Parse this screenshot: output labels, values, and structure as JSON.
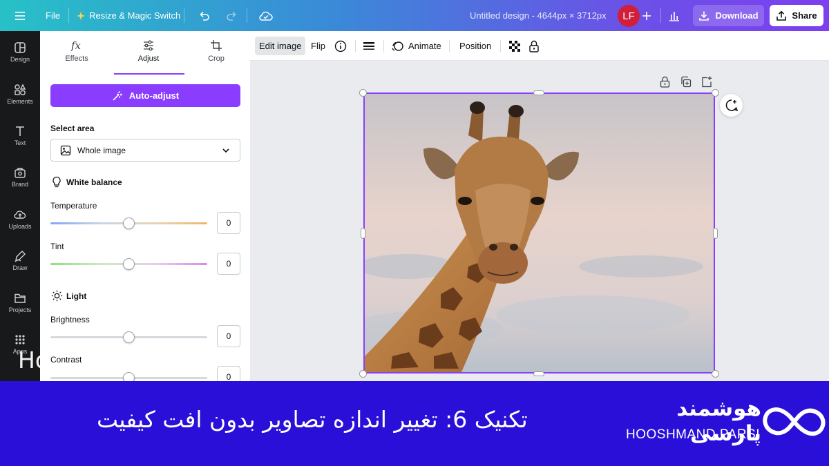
{
  "topbar": {
    "file_label": "File",
    "resize_label": "Resize & Magic Switch",
    "doc_title": "Untitled design - 4644px × 3712px",
    "avatar_initials": "LF",
    "download_label": "Download",
    "share_label": "Share"
  },
  "rail": {
    "items": [
      {
        "label": "Design",
        "icon": "design-icon"
      },
      {
        "label": "Elements",
        "icon": "elements-icon"
      },
      {
        "label": "Text",
        "icon": "text-icon"
      },
      {
        "label": "Brand",
        "icon": "brand-icon"
      },
      {
        "label": "Uploads",
        "icon": "uploads-icon"
      },
      {
        "label": "Draw",
        "icon": "draw-icon"
      },
      {
        "label": "Projects",
        "icon": "projects-icon"
      },
      {
        "label": "Apps",
        "icon": "apps-icon"
      }
    ]
  },
  "panel": {
    "tabs": [
      {
        "label": "Effects",
        "icon": "fx-icon"
      },
      {
        "label": "Adjust",
        "icon": "sliders-icon"
      },
      {
        "label": "Crop",
        "icon": "crop-icon"
      }
    ],
    "active_tab": "Adjust",
    "auto_adjust_label": "Auto-adjust",
    "select_area_label": "Select area",
    "select_area_value": "Whole image",
    "white_balance_heading": "White balance",
    "temperature_label": "Temperature",
    "temperature_value": "0",
    "tint_label": "Tint",
    "tint_value": "0",
    "light_heading": "Light",
    "brightness_label": "Brightness",
    "brightness_value": "0",
    "contrast_label": "Contrast",
    "contrast_value": "0"
  },
  "context_toolbar": {
    "edit_image_label": "Edit image",
    "flip_label": "Flip",
    "animate_label": "Animate",
    "position_label": "Position"
  },
  "watermark": {
    "left_text": "Ho"
  },
  "banner": {
    "title": "تکنیک 6: تغییر اندازه تصاویر بدون افت کیفیت",
    "brand_fa": "هوشمند پارسی",
    "brand_en": "HOOSHMAND PARSI"
  },
  "colors": {
    "accent": "#8b3dff",
    "banner_bg": "#2a0fd8",
    "rail_bg": "#18191b",
    "avatar_bg": "#d11e3a"
  }
}
